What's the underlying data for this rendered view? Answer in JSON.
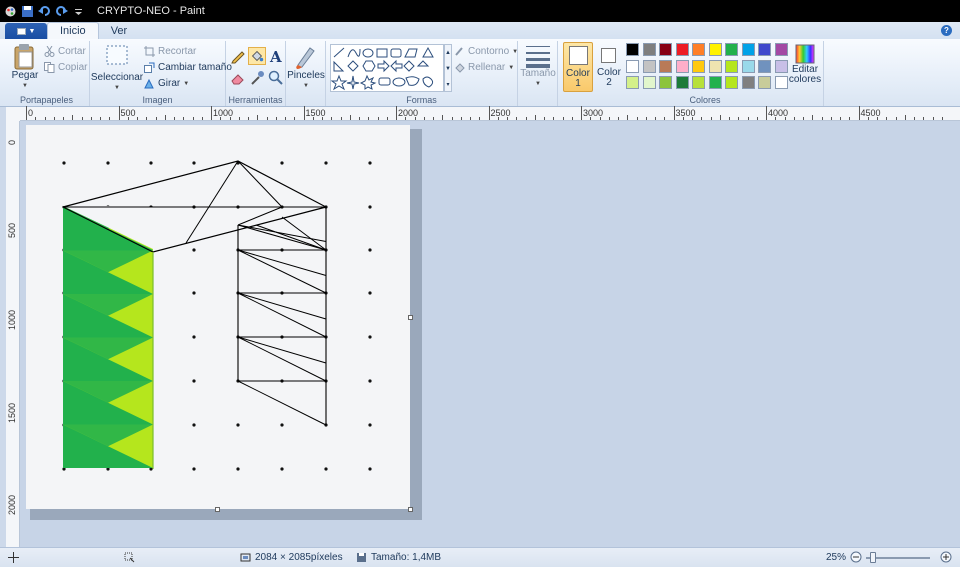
{
  "window": {
    "title": "CRYPTO-NEO - Paint"
  },
  "tabs": [
    {
      "label": "Inicio",
      "active": true
    },
    {
      "label": "Ver",
      "active": false
    }
  ],
  "ribbon": {
    "portapapeles": {
      "label": "Portapapeles",
      "paste": "Pegar",
      "cut": "Cortar",
      "copy": "Copiar"
    },
    "imagen": {
      "label": "Imagen",
      "select": "Seleccionar",
      "crop": "Recortar",
      "resize": "Cambiar tamaño",
      "rotate": "Girar"
    },
    "herramientas": {
      "label": "Herramientas"
    },
    "brushes": {
      "label": "Pinceles"
    },
    "formas": {
      "label": "Formas",
      "outline": "Contorno",
      "fill": "Rellenar"
    },
    "size": {
      "label": "Tamaño"
    },
    "color1": {
      "label": "Color",
      "num": "1",
      "color": "#ffffff"
    },
    "color2": {
      "label": "Color",
      "num": "2",
      "color": "#ffffff"
    },
    "colores": {
      "label": "Colores",
      "edit": "Editar colores"
    },
    "palette_row1": [
      "#000000",
      "#7f7f7f",
      "#880015",
      "#ed1c24",
      "#ff7f27",
      "#fff200",
      "#22b14c",
      "#00a2e8",
      "#3f48cc",
      "#a349a4"
    ],
    "palette_row2": [
      "#ffffff",
      "#c3c3c3",
      "#b97a57",
      "#ffaec9",
      "#ffc90e",
      "#efe4b0",
      "#b5e61d",
      "#99d9ea",
      "#7092be",
      "#c8bfe7"
    ],
    "palette_row3": [
      "#d4f08a",
      "#e2f6cc",
      "#8cc43c",
      "#1d7b3a",
      "#b7e03a",
      "#22b14c",
      "#b5e61d",
      "#808080",
      "#c8cc9a",
      "#ffffff"
    ]
  },
  "ruler": {
    "h_labels": [
      "0",
      "500",
      "1000",
      "1500",
      "2000",
      "2500",
      "3000",
      "3500",
      "4000",
      "4500"
    ],
    "v_labels": [
      "0",
      "500",
      "1000",
      "1500",
      "2000"
    ]
  },
  "status": {
    "dimensions": "2084 × 2085píxeles",
    "size": "Tamaño: 1,4MB",
    "zoom": "25%"
  },
  "drawing": {
    "fill_light": "#b5e61d",
    "fill_dark": "#22b14c",
    "stroke": "#000000"
  }
}
